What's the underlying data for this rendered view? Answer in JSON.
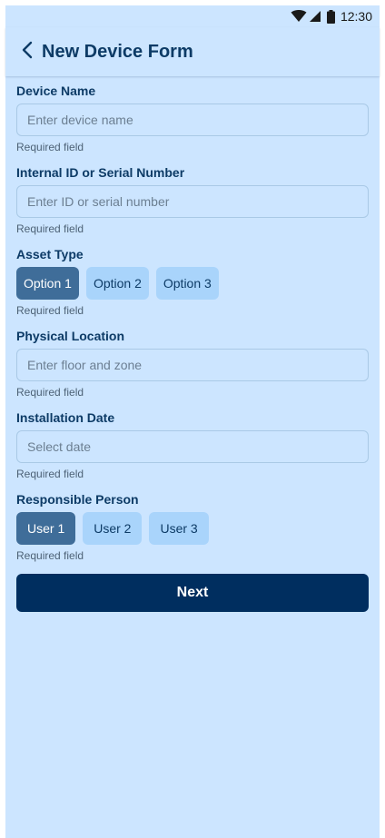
{
  "status_bar": {
    "time": "12:30",
    "icons": [
      "wifi-icon",
      "signal-icon",
      "battery-icon"
    ]
  },
  "app_bar": {
    "back_icon": "chevron-left-icon",
    "title": "New Device Form"
  },
  "form": {
    "device_name": {
      "label": "Device Name",
      "placeholder": "Enter device name",
      "value": "",
      "helper": "Required field"
    },
    "internal_id": {
      "label": "Internal ID or Serial Number",
      "placeholder": "Enter ID or serial number",
      "value": "",
      "helper": "Required field"
    },
    "asset_type": {
      "label": "Asset Type",
      "options": [
        "Option 1",
        "Option 2",
        "Option 3"
      ],
      "selected": "Option 1",
      "helper": "Required field"
    },
    "location": {
      "label": "Physical Location",
      "placeholder": "Enter floor and zone",
      "value": "",
      "helper": "Required field"
    },
    "install_date": {
      "label": "Installation Date",
      "placeholder": "Select date",
      "value": "",
      "helper": "Required field"
    },
    "responsible": {
      "label": "Responsible Person",
      "options": [
        "User 1",
        "User 2",
        "User 3"
      ],
      "selected": "User 1",
      "helper": "Required field"
    },
    "next_label": "Next"
  },
  "colors": {
    "background": "#cce5ff",
    "primary": "#002e5f",
    "selected_chip": "#3f6d99",
    "chip": "#a9d4fb",
    "label": "#0d3b66"
  }
}
